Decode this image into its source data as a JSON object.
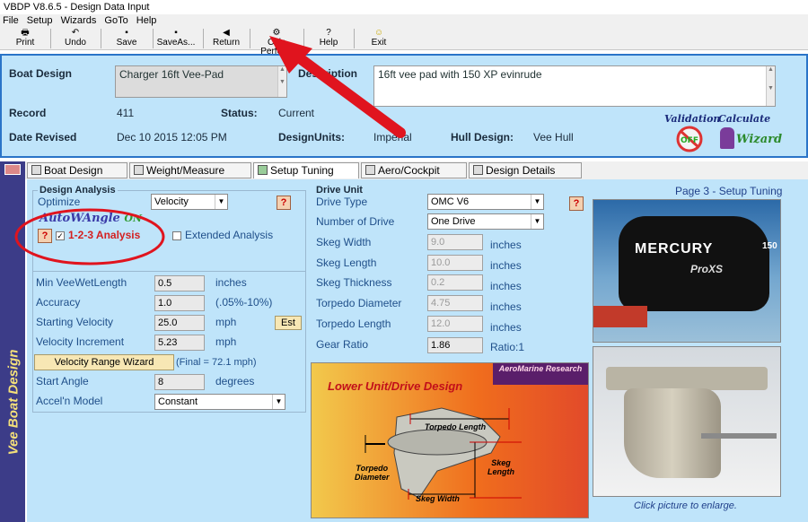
{
  "window": {
    "title": "VBDP V8.6.5 - Design Data Input"
  },
  "menu": [
    "File",
    "Setup",
    "Wizards",
    "GoTo",
    "Help"
  ],
  "toolbar": {
    "print": "Print",
    "undo": "Undo",
    "save": "Save",
    "save_as": "SaveAs...",
    "return": "Return",
    "calc": "Calc Perform",
    "help": "Help",
    "exit": "Exit"
  },
  "header": {
    "boat_design_label": "Boat Design",
    "boat_design_value": "Charger 16ft Vee-Pad",
    "description_label": "Description",
    "description_value": "16ft vee pad with 150 XP evinrude",
    "record_label": "Record",
    "record_value": "411",
    "status_label": "Status:",
    "status_value": "Current",
    "date_label": "Date Revised",
    "date_value": "Dec 10 2015 12:05 PM",
    "units_label": "DesignUnits:",
    "units_value": "Imperial",
    "hull_label": "Hull Design:",
    "hull_value": "Vee Hull",
    "validation_logo": "Validation",
    "wizard_logo_1": "Calculate",
    "wizard_logo_2": "Wizard"
  },
  "sidebar": {
    "vertical_text": "Vee Boat Design"
  },
  "tabs": [
    {
      "label": "Boat Design Input"
    },
    {
      "label": "Weight/Measure Input"
    },
    {
      "label": "Setup Tuning Input"
    },
    {
      "label": "Aero/Cockpit Input"
    },
    {
      "label": "Design Details Input"
    }
  ],
  "analysis": {
    "title": "Design Analysis",
    "optimize_label": "Optimize",
    "optimize_value": "Velocity",
    "autowangle_label": "AutoWAngle",
    "autowangle_state": "ON",
    "analysis_123": "1-2-3 Analysis",
    "extended": "Extended Analysis",
    "min_vee_label": "Min VeeWetLength",
    "min_vee_value": "0.5",
    "min_vee_unit": "inches",
    "accuracy_label": "Accuracy",
    "accuracy_value": "1.0",
    "accuracy_unit": "(.05%-10%)",
    "start_vel_label": "Starting Velocity",
    "start_vel_value": "25.0",
    "start_vel_unit": "mph",
    "est_button": "Est",
    "vel_inc_label": "Velocity Increment",
    "vel_inc_value": "5.23",
    "vel_inc_unit": "mph",
    "wizard_button": "Velocity Range Wizard",
    "final_note": "(Final = 72.1 mph)",
    "start_angle_label": "Start Angle",
    "start_angle_value": "8",
    "start_angle_unit": "degrees",
    "accel_label": "Accel'n Model",
    "accel_value": "Constant"
  },
  "drive": {
    "title": "Drive Unit",
    "type_label": "Drive Type",
    "type_value": "OMC V6",
    "num_label": "Number of Drive",
    "num_value": "One Drive",
    "skeg_width_label": "Skeg Width",
    "skeg_width_value": "9.0",
    "skeg_length_label": "Skeg Length",
    "skeg_length_value": "10.0",
    "skeg_thick_label": "Skeg Thickness",
    "skeg_thick_value": "0.2",
    "torpedo_dia_label": "Torpedo Diameter",
    "torpedo_dia_value": "4.75",
    "torpedo_len_label": "Torpedo Length",
    "torpedo_len_value": "12.0",
    "gear_label": "Gear Ratio",
    "gear_value": "1.86",
    "unit_inches": "inches",
    "gear_unit": "Ratio:1"
  },
  "page_title": "Page 3 - Setup Tuning",
  "diagram": {
    "brand": "AeroMarine Research",
    "title": "Lower Unit/Drive Design",
    "torpedo_length": "Torpedo Length",
    "torpedo_diameter_1": "Torpedo",
    "torpedo_diameter_2": "Diameter",
    "skeg_length_1": "Skeg",
    "skeg_length_2": "Length",
    "skeg_width": "Skeg Width"
  },
  "photo": {
    "motor_brand": "MERCURY",
    "motor_model": "ProXS",
    "motor_hp": "150"
  },
  "enlarge_hint": "Click picture to enlarge."
}
